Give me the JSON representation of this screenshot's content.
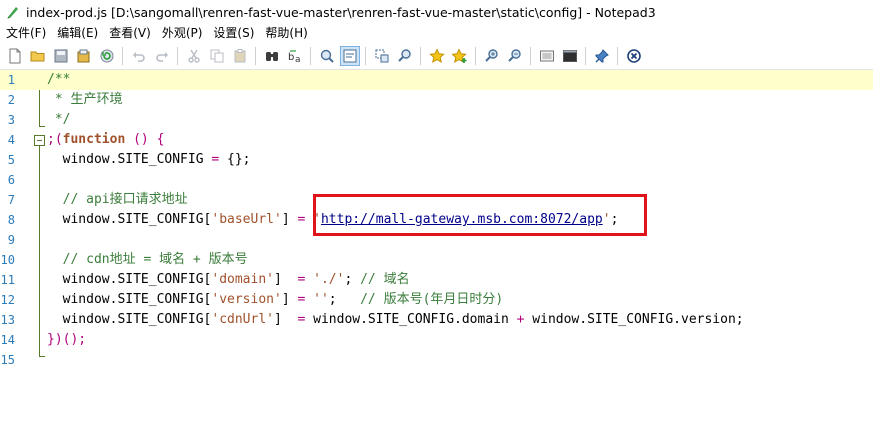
{
  "window": {
    "title": "index-prod.js [D:\\sangomall\\renren-fast-vue-master\\renren-fast-vue-master\\static\\config] - Notepad3"
  },
  "menu": {
    "items": [
      "文件(F)",
      "编辑(E)",
      "查看(V)",
      "外观(P)",
      "设置(S)",
      "帮助(H)"
    ]
  },
  "toolbar": {
    "icons": [
      "new-file-icon",
      "open-folder-icon",
      "save-icon",
      "save-as-icon",
      "revert-icon",
      "undo-icon",
      "redo-icon",
      "cut-icon",
      "copy-icon",
      "paste-icon",
      "find-icon",
      "replace-icon",
      "goto-icon",
      "word-wrap-icon",
      "select-icon",
      "zoom-find-icon",
      "favorite-icon",
      "add-favorite-icon",
      "zoom-in-icon",
      "zoom-out-icon",
      "settings-icon",
      "console-icon",
      "pin-icon",
      "close-icon"
    ]
  },
  "editor": {
    "line_numbers": [
      "1",
      "2",
      "3",
      "4",
      "5",
      "6",
      "7",
      "8",
      "9",
      "10",
      "11",
      "12",
      "13",
      "14",
      "15"
    ],
    "l1": "/**",
    "l2": " * 生产环境",
    "l3": " */",
    "l4_a": ";(",
    "l4_kw": "function",
    "l4_b": " () {",
    "l5_a": "  window.SITE_CONFIG ",
    "l5_op": "=",
    "l5_b": " {};",
    "l7": "  // api接口请求地址",
    "l8_a": "  window.SITE_CONFIG[",
    "l8_key": "'baseUrl'",
    "l8_b": "] ",
    "l8_op": "=",
    "l8_c": " ",
    "l8_q1": "'",
    "l8_url": "http://mall-gateway.msb.com:8072/app",
    "l8_q2": "'",
    "l8_end": ";",
    "l10": "  // cdn地址 = 域名 + 版本号",
    "l11_a": "  window.SITE_CONFIG[",
    "l11_key": "'domain'",
    "l11_b": "]  ",
    "l11_op": "=",
    "l11_c": " ",
    "l11_val": "'./'",
    "l11_d": "; ",
    "l11_cm": "// 域名",
    "l12_a": "  window.SITE_CONFIG[",
    "l12_key": "'version'",
    "l12_b": "] ",
    "l12_op": "=",
    "l12_c": " ",
    "l12_val": "''",
    "l12_d": ";   ",
    "l12_cm": "// 版本号(年月日时分)",
    "l13_a": "  window.SITE_CONFIG[",
    "l13_key": "'cdnUrl'",
    "l13_b": "]  ",
    "l13_op": "=",
    "l13_c": " window.SITE_CONFIG.domain ",
    "l13_op2": "+",
    "l13_d": " window.SITE_CONFIG.version;",
    "l14": "})();"
  }
}
